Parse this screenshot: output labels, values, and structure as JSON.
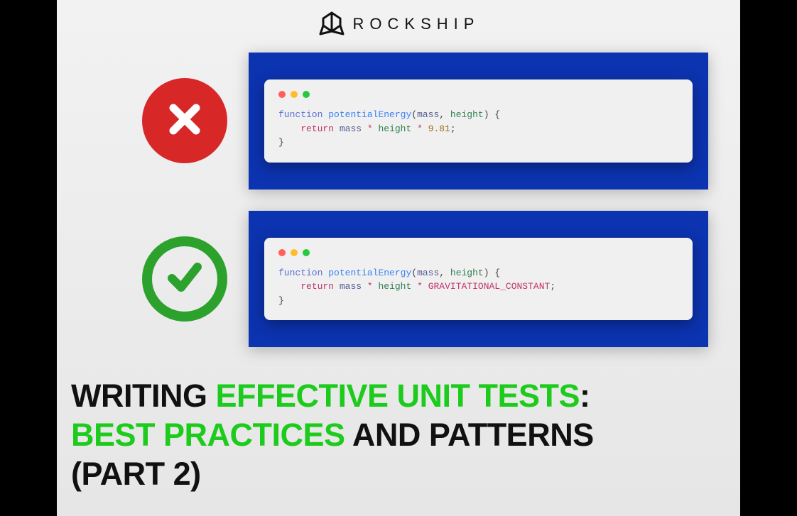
{
  "logo": {
    "text": "ROCKSHIP"
  },
  "examples": {
    "bad": {
      "status": "bad",
      "code": {
        "line1_kw": "function",
        "line1_fn": "potentialEnergy",
        "line1_params_open": "(",
        "line1_param1": "mass",
        "line1_comma": ", ",
        "line1_param2": "height",
        "line1_params_close": ") {",
        "line2_indent": "    ",
        "line2_ret": "return",
        "line2_sp": " ",
        "line2_var1": "mass",
        "line2_op1": " * ",
        "line2_var2": "height",
        "line2_op2": " * ",
        "line2_val": "9.81",
        "line2_semi": ";",
        "line3": "}"
      }
    },
    "good": {
      "status": "good",
      "code": {
        "line1_kw": "function",
        "line1_fn": "potentialEnergy",
        "line1_params_open": "(",
        "line1_param1": "mass",
        "line1_comma": ", ",
        "line1_param2": "height",
        "line1_params_close": ") {",
        "line2_indent": "    ",
        "line2_ret": "return",
        "line2_sp": " ",
        "line2_var1": "mass",
        "line2_op1": " * ",
        "line2_var2": "height",
        "line2_op2": " * ",
        "line2_val": "GRAVITATIONAL_CONSTANT",
        "line2_semi": ";",
        "line3": "}"
      }
    }
  },
  "title": {
    "part1": "WRITING ",
    "part2": "EFFECTIVE UNIT TESTS",
    "part3": ":",
    "part4": "BEST PRACTICES",
    "part5": " AND PATTERNS",
    "part6": "(PART 2)"
  },
  "colors": {
    "bad": "#d82727",
    "good": "#2ca22c",
    "highlight": "#1dcb1d",
    "panel_bg": "#0c33b0"
  }
}
